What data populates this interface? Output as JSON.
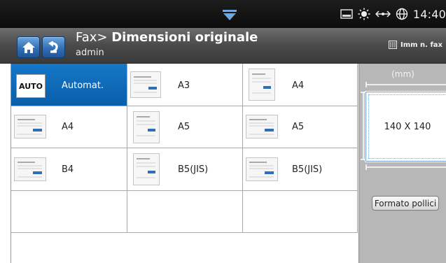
{
  "statusbar": {
    "time": "14:40",
    "icons": [
      "pulldown-arrow-icon",
      "toner-icon",
      "sun-icon",
      "network-icon",
      "globe-icon"
    ]
  },
  "header": {
    "title_prefix": "Fax> ",
    "title_main": "Dimensioni originale",
    "user": "admin",
    "imm_fax_label": "Imm n. fax"
  },
  "sizes": [
    {
      "label": "Automat.",
      "selected": true,
      "type": "auto",
      "badge": "AUTO"
    },
    {
      "label": "A3",
      "type": "portrait"
    },
    {
      "label": "A4",
      "type": "portrait"
    },
    {
      "label": "A4",
      "type": "landscape"
    },
    {
      "label": "A5",
      "type": "portrait"
    },
    {
      "label": "A5",
      "type": "landscape"
    },
    {
      "label": "B4",
      "type": "landscape"
    },
    {
      "label": "B5(JIS)",
      "type": "portrait"
    },
    {
      "label": "B5(JIS)",
      "type": "landscape"
    }
  ],
  "sidepanel": {
    "unit": "(mm)",
    "size_value": "140 X 140",
    "inch_button": "Formato pollici"
  },
  "colors": {
    "accent": "#0a66b3",
    "status_bar": "#111111",
    "header": "#4a4a4a",
    "side_panel": "#b7b7b7"
  }
}
